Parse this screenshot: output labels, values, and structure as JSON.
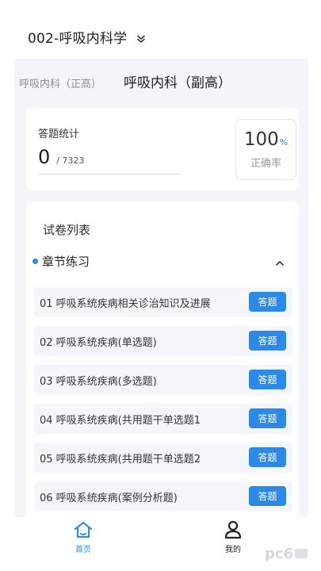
{
  "header": {
    "subject_title": "002-呼吸内科学"
  },
  "levels": {
    "inactive_label": "呼吸内科（正高）",
    "active_label": "呼吸内科（副高）"
  },
  "stats": {
    "label": "答题统计",
    "answered": "0",
    "total": "/ 7323",
    "accuracy_value": "100",
    "accuracy_unit": "%",
    "accuracy_label": "正确率"
  },
  "paper_list": {
    "title": "试卷列表",
    "section_title": "章节练习",
    "items": [
      {
        "label": "01   呼吸系统疾病相关诊治知识及进展",
        "button": "答题"
      },
      {
        "label": "02   呼吸系统疾病(单选题)",
        "button": "答题"
      },
      {
        "label": "03   呼吸系统疾病(多选题)",
        "button": "答题"
      },
      {
        "label": "04   呼吸系统疾病(共用题干单选题1",
        "button": "答题"
      },
      {
        "label": "05   呼吸系统疾病(共用题干单选题2",
        "button": "答题"
      },
      {
        "label": "06   呼吸系统疾病(案例分析题)",
        "button": "答题"
      }
    ]
  },
  "tabbar": {
    "home_label": "首页",
    "mine_label": "我的"
  },
  "colors": {
    "accent": "#2f8ae0",
    "button": "#2c8ae6",
    "background": "#f3f5fa"
  },
  "icons": {
    "subject_switch": "double-chevron-down-icon",
    "collapse": "chevron-up-icon",
    "home": "home-icon",
    "mine": "user-icon",
    "watermark": "pc6-logo"
  }
}
